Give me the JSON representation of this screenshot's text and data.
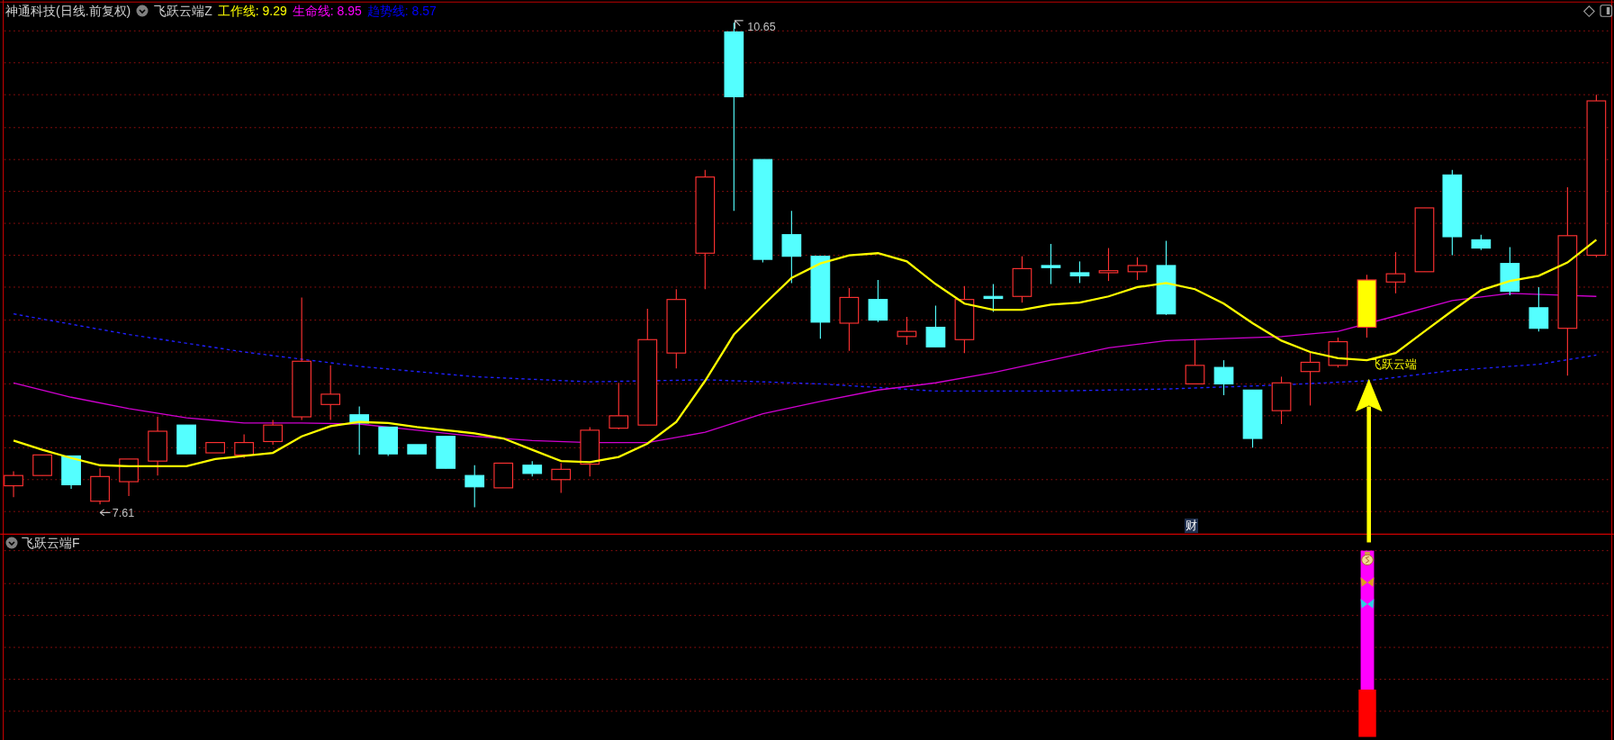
{
  "header": {
    "stock": "神通科技(日线.前复权)",
    "indicator": "飞跃云端Z",
    "lines": [
      {
        "text": "工作线: 9.29",
        "color": "#ffff00"
      },
      {
        "text": "生命线: 8.95",
        "color": "#ff00ff"
      },
      {
        "text": "趋势线: 8.57",
        "color": "#0000ff"
      }
    ]
  },
  "main_chart": {
    "high_label": "10.65",
    "low_label": "7.61",
    "signal_label": "飞跃云端",
    "marker": "财"
  },
  "lower_panel": {
    "title": "飞跃云端F"
  }
}
